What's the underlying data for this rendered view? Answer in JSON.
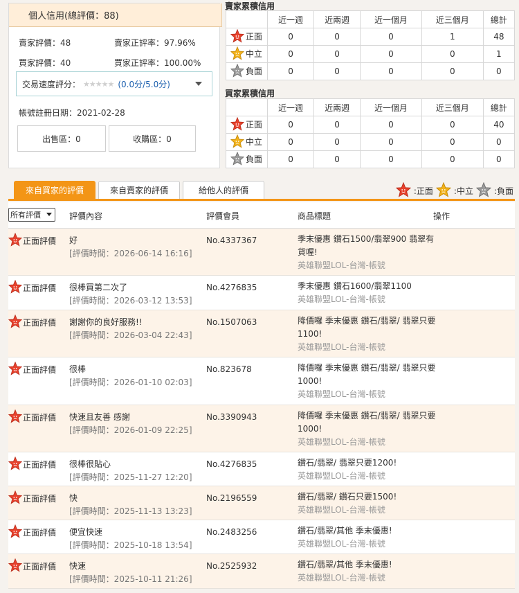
{
  "personal_credit": {
    "title": "個人信用(總評價：88)",
    "seller_rating_label": "賣家評價：48",
    "seller_positive_rate": "賣家正評率：97.96%",
    "buyer_rating_label": "買家評價：40",
    "buyer_positive_rate": "買家正評率：100.00%",
    "speed_label": "交易速度評分：",
    "speed_stars": "★★★★★",
    "speed_value": "(0.0分/5.0分)",
    "register_date": "帳號註冊日期：2021-02-28",
    "sale_zone": "出售區：0",
    "buy_zone": "收購區：0"
  },
  "seller_table": {
    "title": "賣家累積信用",
    "columns": [
      "近一週",
      "近兩週",
      "近一個月",
      "近三個月",
      "總計"
    ],
    "rows": [
      {
        "label": "正面",
        "values": [
          "0",
          "0",
          "0",
          "1",
          "48"
        ]
      },
      {
        "label": "中立",
        "values": [
          "0",
          "0",
          "0",
          "0",
          "1"
        ]
      },
      {
        "label": "負面",
        "values": [
          "0",
          "0",
          "0",
          "0",
          "0"
        ]
      }
    ]
  },
  "buyer_table": {
    "title": "買家累積信用",
    "columns": [
      "近一週",
      "近兩週",
      "近一個月",
      "近三個月",
      "總計"
    ],
    "rows": [
      {
        "label": "正面",
        "values": [
          "0",
          "0",
          "0",
          "0",
          "40"
        ]
      },
      {
        "label": "中立",
        "values": [
          "0",
          "0",
          "0",
          "0",
          "0"
        ]
      },
      {
        "label": "負面",
        "values": [
          "0",
          "0",
          "0",
          "0",
          "0"
        ]
      }
    ]
  },
  "tabs": [
    "來自買家的評價",
    "來自賣家的評價",
    "給他人的評價"
  ],
  "legend": {
    "positive": ":正面",
    "neutral": ":中立",
    "negative": ":負面"
  },
  "list_header": {
    "filter": "所有評價",
    "content": "評價內容",
    "member": "評價會員",
    "product": "商品標題",
    "action": "操作"
  },
  "reviews": [
    {
      "type": "正面評價",
      "content": "好",
      "time": "[評價時間：2026-06-14 16:16]",
      "member": "No.4337367",
      "product": "季末優惠 鑽石1500/翡翠900 翡翠有貨喔!",
      "game": "英雄聯盟LOL-台灣-帳號"
    },
    {
      "type": "正面評價",
      "content": "很棒買第二次了",
      "time": "[評價時間：2026-03-12 13:53]",
      "member": "No.4276835",
      "product": "季末優惠 鑽石1600/翡翠1100",
      "game": "英雄聯盟LOL-台灣-帳號"
    },
    {
      "type": "正面評價",
      "content": "謝謝你的良好服務!!",
      "time": "[評價時間：2026-03-04 22:43]",
      "member": "No.1507063",
      "product": "降價囉 季末優惠 鑽石/翡翠/ 翡翠只要1100!",
      "game": "英雄聯盟LOL-台灣-帳號"
    },
    {
      "type": "正面評價",
      "content": "很棒",
      "time": "[評價時間：2026-01-10 02:03]",
      "member": "No.823678",
      "product": "降價囉 季末優惠 鑽石/翡翠/ 翡翠只要1000!",
      "game": "英雄聯盟LOL-台灣-帳號"
    },
    {
      "type": "正面評價",
      "content": "快速且友善 感謝",
      "time": "[評價時間：2026-01-09 22:25]",
      "member": "No.3390943",
      "product": "降價囉 季末優惠 鑽石/翡翠/ 翡翠只要1000!",
      "game": "英雄聯盟LOL-台灣-帳號"
    },
    {
      "type": "正面評價",
      "content": "很棒很貼心",
      "time": "[評價時間：2025-11-27 12:20]",
      "member": "No.4276835",
      "product": "鑽石/翡翠/ 翡翠只要1200!",
      "game": "英雄聯盟LOL-台灣-帳號"
    },
    {
      "type": "正面評價",
      "content": "快",
      "time": "[評價時間：2025-11-13 13:23]",
      "member": "No.2196559",
      "product": "鑽石/翡翠/ 鑽石只要1500!",
      "game": "英雄聯盟LOL-台灣-帳號"
    },
    {
      "type": "正面評價",
      "content": "便宜快速",
      "time": "[評價時間：2025-10-18 13:54]",
      "member": "No.2483256",
      "product": "鑽石/翡翠/其他 季末優惠!",
      "game": "英雄聯盟LOL-台灣-帳號"
    },
    {
      "type": "正面評價",
      "content": "快速",
      "time": "[評價時間：2025-10-11 21:26]",
      "member": "No.2525932",
      "product": "鑽石/翡翠/其他 季末優惠!",
      "game": "英雄聯盟LOL-台灣-帳號"
    }
  ],
  "colors": {
    "accent": "#f39516",
    "positive_icon": "#e8412c",
    "neutral_icon": "#f2b21a",
    "negative_icon": "#9b9b9b",
    "row_alt": "#fdf3e8"
  },
  "icons": {
    "positive": "star-face-red-icon",
    "neutral": "star-face-yellow-icon",
    "negative": "star-face-gray-icon"
  }
}
